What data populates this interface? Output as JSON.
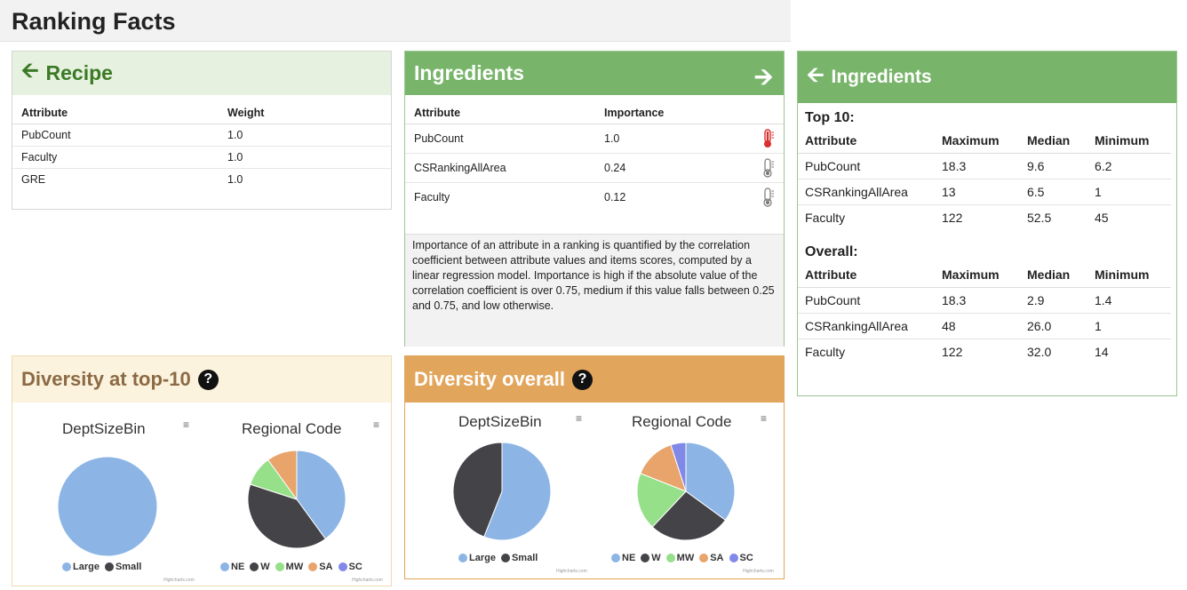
{
  "page_title": "Ranking Facts",
  "recipe": {
    "title": "Recipe",
    "headers": [
      "Attribute",
      "Weight"
    ],
    "rows": [
      {
        "attribute": "PubCount",
        "weight": "1.0"
      },
      {
        "attribute": "Faculty",
        "weight": "1.0"
      },
      {
        "attribute": "GRE",
        "weight": "1.0"
      }
    ]
  },
  "ingredients": {
    "title": "Ingredients",
    "headers": [
      "Attribute",
      "Importance"
    ],
    "rows": [
      {
        "attribute": "PubCount",
        "importance": "1.0",
        "level": "high"
      },
      {
        "attribute": "CSRankingAllArea",
        "importance": "0.24",
        "level": "low"
      },
      {
        "attribute": "Faculty",
        "importance": "0.12",
        "level": "low"
      }
    ],
    "description": "Importance of an attribute in a ranking is quantified by the correlation coefficient between attribute values and items scores, computed by a linear regression model. Importance is high if the absolute value of the correlation coefficient is over 0.75, medium if this value falls between 0.25 and 0.75, and low otherwise."
  },
  "ingredients_detail": {
    "title": "Ingredients",
    "top10_label": "Top 10:",
    "overall_label": "Overall:",
    "headers": [
      "Attribute",
      "Maximum",
      "Median",
      "Minimum"
    ],
    "top10_rows": [
      {
        "attribute": "PubCount",
        "max": "18.3",
        "median": "9.6",
        "min": "6.2"
      },
      {
        "attribute": "CSRankingAllArea",
        "max": "13",
        "median": "6.5",
        "min": "1"
      },
      {
        "attribute": "Faculty",
        "max": "122",
        "median": "52.5",
        "min": "45"
      }
    ],
    "overall_rows": [
      {
        "attribute": "PubCount",
        "max": "18.3",
        "median": "2.9",
        "min": "1.4"
      },
      {
        "attribute": "CSRankingAllArea",
        "max": "48",
        "median": "26.0",
        "min": "1"
      },
      {
        "attribute": "Faculty",
        "max": "122",
        "median": "32.0",
        "min": "14"
      }
    ]
  },
  "diversity_top10": {
    "title": "Diversity at top-10",
    "help": "?"
  },
  "diversity_overall": {
    "title": "Diversity overall",
    "help": "?"
  },
  "menu_glyph": "≡",
  "credit": "Highcharts.com",
  "colors": {
    "recipe_head": "#e7f1df",
    "ingredients_head": "#78b56b",
    "div10_head": "#fbf3dd",
    "divall_head": "#e2a55c",
    "thermo_high": "#d9302f",
    "thermo_low": "#777777"
  },
  "chart_data": [
    {
      "type": "pie",
      "title": "DeptSizeBin",
      "categories": [
        "Large",
        "Small"
      ],
      "values": [
        100,
        0
      ],
      "colors": [
        "#8cb5e6",
        "#444448"
      ]
    },
    {
      "type": "pie",
      "title": "Regional Code",
      "categories": [
        "NE",
        "W",
        "MW",
        "SA",
        "SC"
      ],
      "values": [
        40,
        40,
        10,
        10,
        0
      ],
      "colors": [
        "#8cb5e6",
        "#444448",
        "#96e08a",
        "#e8a46a",
        "#8088e8"
      ]
    },
    {
      "type": "pie",
      "title": "DeptSizeBin",
      "categories": [
        "Large",
        "Small"
      ],
      "values": [
        56,
        44
      ],
      "colors": [
        "#8cb5e6",
        "#444448"
      ]
    },
    {
      "type": "pie",
      "title": "Regional Code",
      "categories": [
        "NE",
        "W",
        "MW",
        "SA",
        "SC"
      ],
      "values": [
        35,
        27,
        19,
        14,
        5
      ],
      "colors": [
        "#8cb5e6",
        "#444448",
        "#96e08a",
        "#e8a46a",
        "#8088e8"
      ]
    }
  ]
}
